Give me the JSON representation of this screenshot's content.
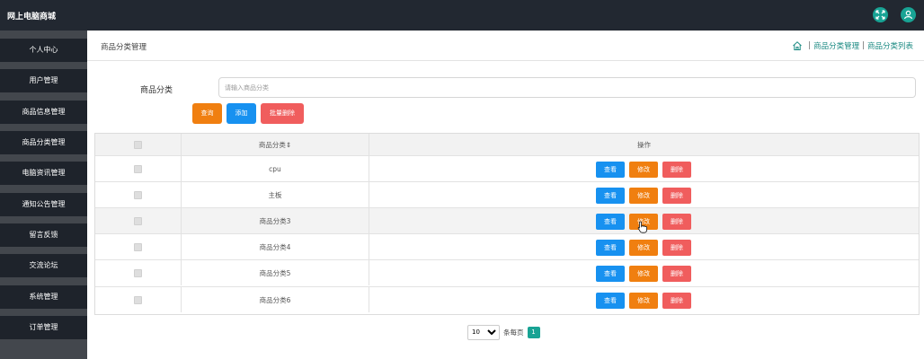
{
  "app": {
    "title": "网上电脑商城"
  },
  "topbar_icons": [
    "fullscreen-icon",
    "user-icon"
  ],
  "accent_color": "#18a394",
  "sidebar": {
    "items": [
      {
        "label": "个人中心"
      },
      {
        "label": "用户管理"
      },
      {
        "label": "商品信息管理"
      },
      {
        "label": "商品分类管理"
      },
      {
        "label": "电脑资讯管理"
      },
      {
        "label": "通知公告管理"
      },
      {
        "label": "留言反馈"
      },
      {
        "label": "交流论坛"
      },
      {
        "label": "系统管理"
      },
      {
        "label": "订单管理"
      }
    ]
  },
  "header": {
    "title": "商品分类管理",
    "breadcrumb": {
      "sep1": "|",
      "item1": "商品分类管理",
      "sep2": "|",
      "item2": "商品分类列表"
    }
  },
  "search": {
    "label": "商品分类",
    "placeholder": "请输入商品分类",
    "value": ""
  },
  "buttons": {
    "query": "查询",
    "add": "添加",
    "batch_delete": "批量删除"
  },
  "table": {
    "headers": {
      "category": "商品分类⇕",
      "actions": "操作"
    },
    "rows": [
      {
        "category": "cpu"
      },
      {
        "category": "主板"
      },
      {
        "category": "商品分类3"
      },
      {
        "category": "商品分类4"
      },
      {
        "category": "商品分类5"
      },
      {
        "category": "商品分类6"
      }
    ],
    "actions": {
      "view": "查看",
      "edit": "修改",
      "delete": "删除"
    }
  },
  "pagination": {
    "page_size": "10",
    "per_page_label": "条每页",
    "current_page": "1"
  }
}
